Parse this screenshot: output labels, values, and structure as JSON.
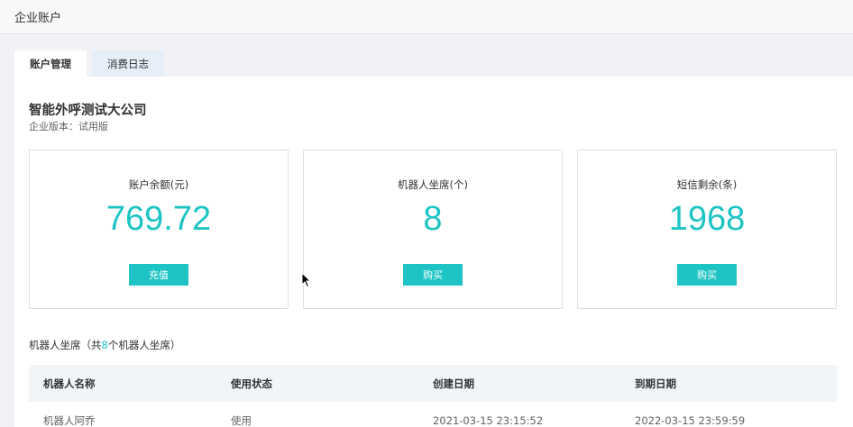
{
  "page": {
    "title": "企业账户"
  },
  "tabs": [
    {
      "label": "账户管理",
      "active": true
    },
    {
      "label": "消费日志",
      "active": false
    }
  ],
  "company": {
    "name": "智能外呼测试大公司",
    "edition": "企业版本：试用版"
  },
  "cards": [
    {
      "label": "账户余额(元)",
      "value": "769.72",
      "button": "充值"
    },
    {
      "label": "机器人坐席(个)",
      "value": "8",
      "button": "购买"
    },
    {
      "label": "短信剩余(条)",
      "value": "1968",
      "button": "购买"
    }
  ],
  "robots": {
    "title_prefix": "机器人坐席（共",
    "count": "8",
    "title_suffix": "个机器人坐席）",
    "columns": [
      "机器人名称",
      "使用状态",
      "创建日期",
      "到期日期"
    ],
    "rows": [
      [
        "机器人阿乔",
        "使用",
        "2021-03-15 23:15:52",
        "2022-03-15 23:59:59"
      ]
    ]
  },
  "colors": {
    "accent": "#1ec4c4",
    "tab_bg": "#e6eef8",
    "page_bg": "#f0f2f5"
  }
}
